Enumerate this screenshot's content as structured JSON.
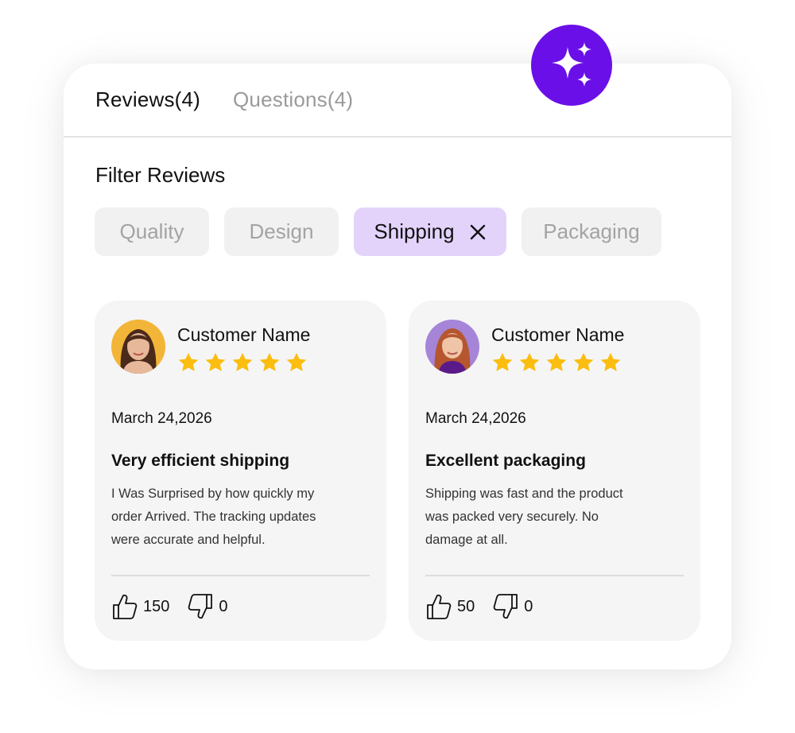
{
  "tabs": [
    {
      "label": "Reviews(4)",
      "active": true
    },
    {
      "label": "Questions(4)",
      "active": false
    }
  ],
  "filter": {
    "title": "Filter Reviews",
    "chips": [
      {
        "label": "Quality",
        "selected": false
      },
      {
        "label": "Design",
        "selected": false
      },
      {
        "label": "Shipping",
        "selected": true
      },
      {
        "label": "Packaging",
        "selected": false
      }
    ]
  },
  "reviews": [
    {
      "customer_name": "Customer Name",
      "rating": 5,
      "date": "March 24,2026",
      "title": "Very efficient shipping",
      "body_lines": [
        "I Was Surprised by how quickly my",
        "order Arrived. The tracking updates",
        "were accurate and helpful."
      ],
      "likes": "150",
      "dislikes": "0",
      "avatar_bg": "#f2b537"
    },
    {
      "customer_name": "Customer Name",
      "rating": 5,
      "date": "March 24,2026",
      "title": "Excellent packaging",
      "body_lines": [
        "Shipping was fast and the product",
        "was packed very securely. No",
        "damage at all."
      ],
      "likes": "50",
      "dislikes": "0",
      "avatar_bg": "#a685d8"
    }
  ],
  "colors": {
    "accent": "#6a0fe8",
    "selected_chip": "#e3d3fb",
    "star": "#fbbd10",
    "card_bg": "#f5f5f5"
  },
  "icons": [
    "sparkles-icon",
    "close-icon",
    "star-icon",
    "thumbs-up-icon",
    "thumbs-down-icon"
  ]
}
